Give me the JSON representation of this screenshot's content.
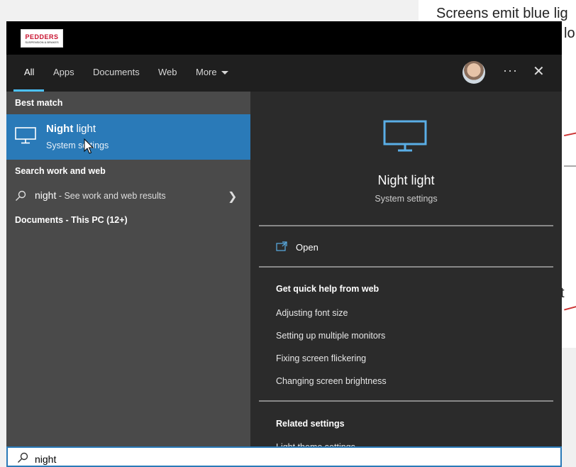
{
  "background_doc": {
    "line1": "Screens emit blue lig",
    "line2": "lor",
    "line3": "t"
  },
  "window": {
    "logo": {
      "line1": "PEDDERS",
      "line2": "SUSPENSION & BRAKES"
    },
    "tabs": [
      {
        "label": "All",
        "active": true
      },
      {
        "label": "Apps"
      },
      {
        "label": "Documents"
      },
      {
        "label": "Web"
      },
      {
        "label": "More"
      }
    ],
    "more_icon": "ellipsis-icon",
    "close_icon": "close-icon",
    "accent": "#2a7ab8"
  },
  "left": {
    "best_match_header": "Best match",
    "best_match": {
      "title_bold": "Night",
      "title_rest": " light",
      "subtitle": "System settings"
    },
    "search_web_header": "Search work and web",
    "web_query": "night",
    "web_query_suffix": " - See work and web results",
    "documents_header": "Documents - This PC (12+)"
  },
  "right": {
    "title": "Night light",
    "subtitle": "System settings",
    "open_label": "Open",
    "quick_help_header": "Get quick help from web",
    "quick_help_links": [
      "Adjusting font size",
      "Setting up multiple monitors",
      "Fixing screen flickering",
      "Changing screen brightness"
    ],
    "related_header": "Related settings",
    "related_partial": "Light theme settings"
  },
  "search": {
    "value": "night"
  }
}
